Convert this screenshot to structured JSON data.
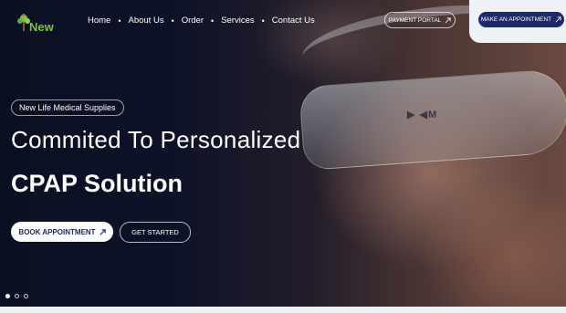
{
  "brand": {
    "logo_text": "New"
  },
  "nav": {
    "items": [
      "Home",
      "About Us",
      "Order",
      "Services",
      "Contact Us"
    ]
  },
  "header": {
    "payment_label": "PAYMENT PORTAL",
    "appointment_label": "MAKE AN APPOINTMENT"
  },
  "hero": {
    "tag": "New Life Medical Supplies",
    "headline": "Commited To Personalized",
    "subheadline": "CPAP Solution",
    "book_label": "BOOK APPOINTMENT",
    "start_label": "GET STARTED",
    "mask_mark": "▶ ◀M"
  },
  "slider": {
    "count": 3,
    "active": 1
  },
  "colors": {
    "brand_green": "#7ec242",
    "navy": "#1b2a6a",
    "text_white": "#ffffff"
  },
  "icons": {
    "button_arrow": "arrow-up-right-icon",
    "logo": "tree-icon"
  }
}
